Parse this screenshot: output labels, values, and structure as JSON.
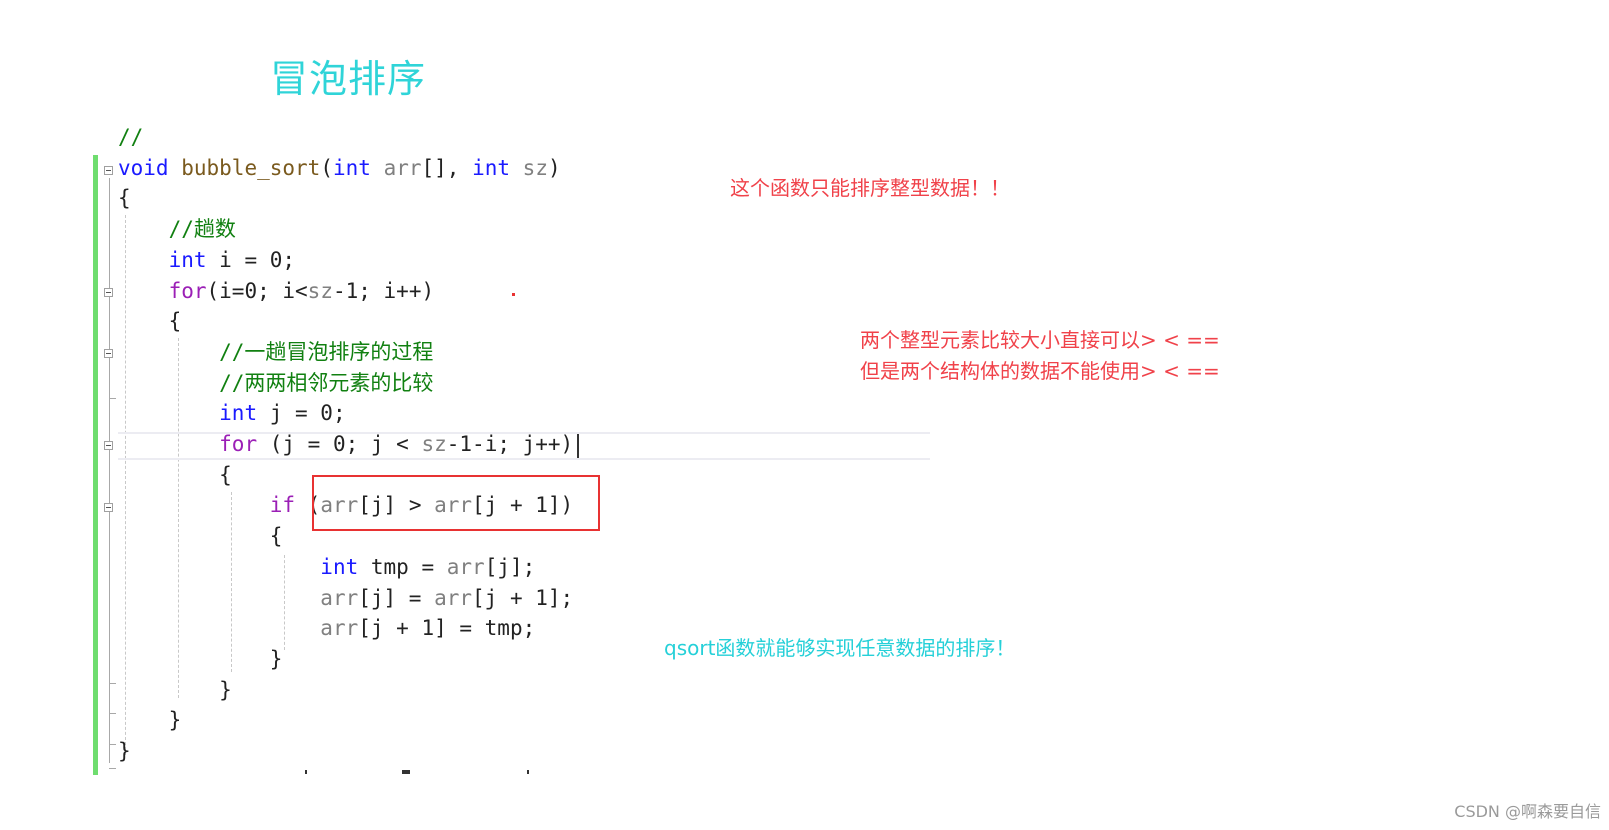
{
  "title": "冒泡排序",
  "code": {
    "lines": [
      {
        "tokens": [
          {
            "t": "//",
            "c": "cm"
          }
        ]
      },
      {
        "tokens": [
          {
            "t": "void",
            "c": "kw"
          },
          {
            "t": " ",
            "c": ""
          },
          {
            "t": "bubble_sort",
            "c": "fn"
          },
          {
            "t": "(",
            "c": ""
          },
          {
            "t": "int",
            "c": "kw"
          },
          {
            "t": " ",
            "c": ""
          },
          {
            "t": "arr",
            "c": "id"
          },
          {
            "t": "[], ",
            "c": ""
          },
          {
            "t": "int",
            "c": "kw"
          },
          {
            "t": " ",
            "c": ""
          },
          {
            "t": "sz",
            "c": "id"
          },
          {
            "t": ")",
            "c": ""
          }
        ]
      },
      {
        "tokens": [
          {
            "t": "{",
            "c": ""
          }
        ]
      },
      {
        "tokens": [
          {
            "t": "    //趟数",
            "c": "cm"
          }
        ]
      },
      {
        "tokens": [
          {
            "t": "    ",
            "c": ""
          },
          {
            "t": "int",
            "c": "kw"
          },
          {
            "t": " i = 0;",
            "c": ""
          }
        ]
      },
      {
        "tokens": [
          {
            "t": "    ",
            "c": ""
          },
          {
            "t": "for",
            "c": "kwc"
          },
          {
            "t": "(i=0; i<",
            "c": ""
          },
          {
            "t": "sz",
            "c": "id"
          },
          {
            "t": "-1; i++)",
            "c": ""
          }
        ]
      },
      {
        "tokens": [
          {
            "t": "    {",
            "c": ""
          }
        ]
      },
      {
        "tokens": [
          {
            "t": "        //一趟冒泡排序的过程",
            "c": "cm"
          }
        ]
      },
      {
        "tokens": [
          {
            "t": "        //两两相邻元素的比较",
            "c": "cm"
          }
        ]
      },
      {
        "tokens": [
          {
            "t": "        ",
            "c": ""
          },
          {
            "t": "int",
            "c": "kw"
          },
          {
            "t": " j = 0;",
            "c": ""
          }
        ]
      },
      {
        "tokens": [
          {
            "t": "        ",
            "c": ""
          },
          {
            "t": "for",
            "c": "kwc"
          },
          {
            "t": " (j = 0; j < ",
            "c": ""
          },
          {
            "t": "sz",
            "c": "id"
          },
          {
            "t": "-1-i; j++)",
            "c": ""
          }
        ]
      },
      {
        "tokens": [
          {
            "t": "        {",
            "c": ""
          }
        ]
      },
      {
        "tokens": [
          {
            "t": "            ",
            "c": ""
          },
          {
            "t": "if",
            "c": "kwc"
          },
          {
            "t": " (",
            "c": ""
          },
          {
            "t": "arr",
            "c": "id"
          },
          {
            "t": "[j] > ",
            "c": ""
          },
          {
            "t": "arr",
            "c": "id"
          },
          {
            "t": "[j + 1])",
            "c": ""
          }
        ]
      },
      {
        "tokens": [
          {
            "t": "            {",
            "c": ""
          }
        ]
      },
      {
        "tokens": [
          {
            "t": "                ",
            "c": ""
          },
          {
            "t": "int",
            "c": "kw"
          },
          {
            "t": " tmp = ",
            "c": ""
          },
          {
            "t": "arr",
            "c": "id"
          },
          {
            "t": "[j];",
            "c": ""
          }
        ]
      },
      {
        "tokens": [
          {
            "t": "                ",
            "c": ""
          },
          {
            "t": "arr",
            "c": "id"
          },
          {
            "t": "[j] = ",
            "c": ""
          },
          {
            "t": "arr",
            "c": "id"
          },
          {
            "t": "[j + 1];",
            "c": ""
          }
        ]
      },
      {
        "tokens": [
          {
            "t": "                ",
            "c": ""
          },
          {
            "t": "arr",
            "c": "id"
          },
          {
            "t": "[j + 1] = tmp;",
            "c": ""
          }
        ]
      },
      {
        "tokens": [
          {
            "t": "            }",
            "c": ""
          }
        ]
      },
      {
        "tokens": [
          {
            "t": "        }",
            "c": ""
          }
        ]
      },
      {
        "tokens": [
          {
            "t": "    }",
            "c": ""
          }
        ]
      },
      {
        "tokens": [
          {
            "t": "}",
            "c": ""
          }
        ]
      }
    ]
  },
  "notes": {
    "int_only": "这个函数只能排序整型数据！！",
    "compare_int": "两个整型元素比较大小直接可以> < ==",
    "compare_struct": "但是两个结构体的数据不能使用> < ==",
    "qsort": "qsort函数就能够实现任意数据的排序！"
  },
  "colors": {
    "title": "#2fd4d8",
    "note_red": "#f0424a",
    "note_cyan": "#25d0d8",
    "highlight_box": "#e83232",
    "change_bar": "#6fdd6f"
  },
  "watermark": "CSDN @啊森要自信"
}
